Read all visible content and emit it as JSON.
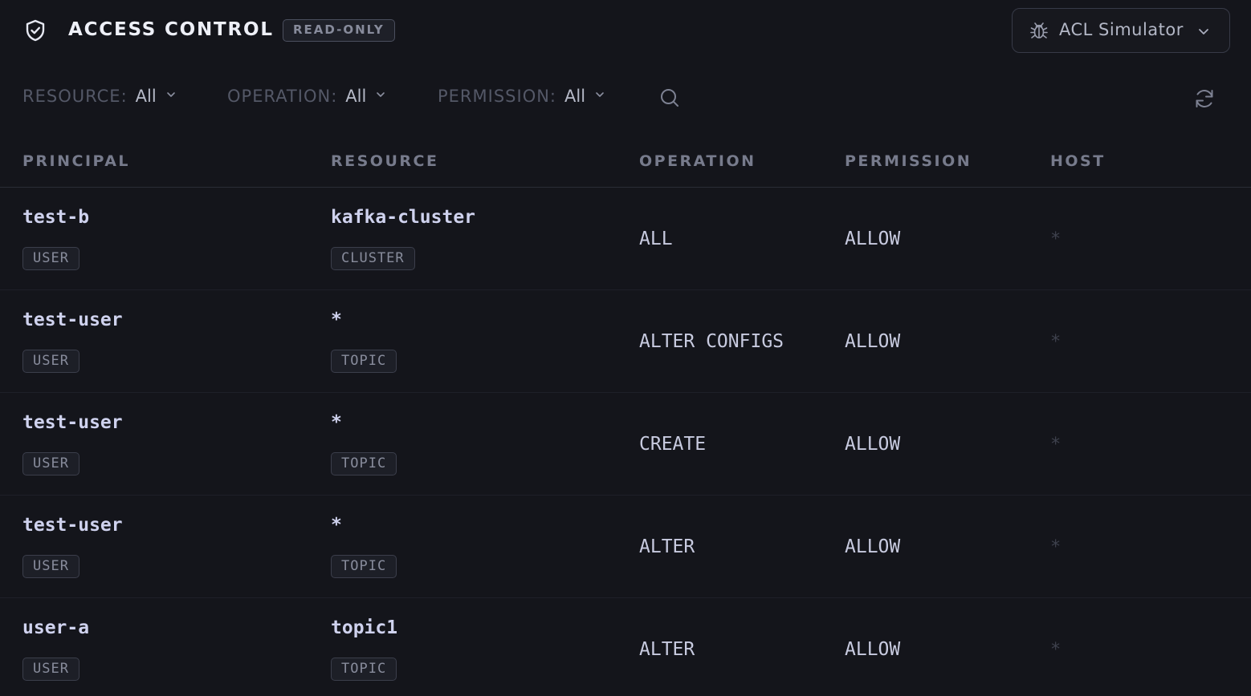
{
  "header": {
    "title": "ACCESS CONTROL",
    "badge": "READ-ONLY",
    "simulator_label": "ACL Simulator"
  },
  "filters": [
    {
      "label": "RESOURCE:",
      "value": "All"
    },
    {
      "label": "OPERATION:",
      "value": "All"
    },
    {
      "label": "PERMISSION:",
      "value": "All"
    }
  ],
  "columns": [
    "PRINCIPAL",
    "RESOURCE",
    "OPERATION",
    "PERMISSION",
    "HOST"
  ],
  "rows": [
    {
      "principal": "test-b",
      "principal_type": "USER",
      "resource": "kafka-cluster",
      "resource_type": "CLUSTER",
      "operation": "ALL",
      "permission": "ALLOW",
      "host": "*"
    },
    {
      "principal": "test-user",
      "principal_type": "USER",
      "resource": "*",
      "resource_type": "TOPIC",
      "operation": "ALTER CONFIGS",
      "permission": "ALLOW",
      "host": "*"
    },
    {
      "principal": "test-user",
      "principal_type": "USER",
      "resource": "*",
      "resource_type": "TOPIC",
      "operation": "CREATE",
      "permission": "ALLOW",
      "host": "*"
    },
    {
      "principal": "test-user",
      "principal_type": "USER",
      "resource": "*",
      "resource_type": "TOPIC",
      "operation": "ALTER",
      "permission": "ALLOW",
      "host": "*"
    },
    {
      "principal": "user-a",
      "principal_type": "USER",
      "resource": "topic1",
      "resource_type": "TOPIC",
      "operation": "ALTER",
      "permission": "ALLOW",
      "host": "*"
    }
  ]
}
